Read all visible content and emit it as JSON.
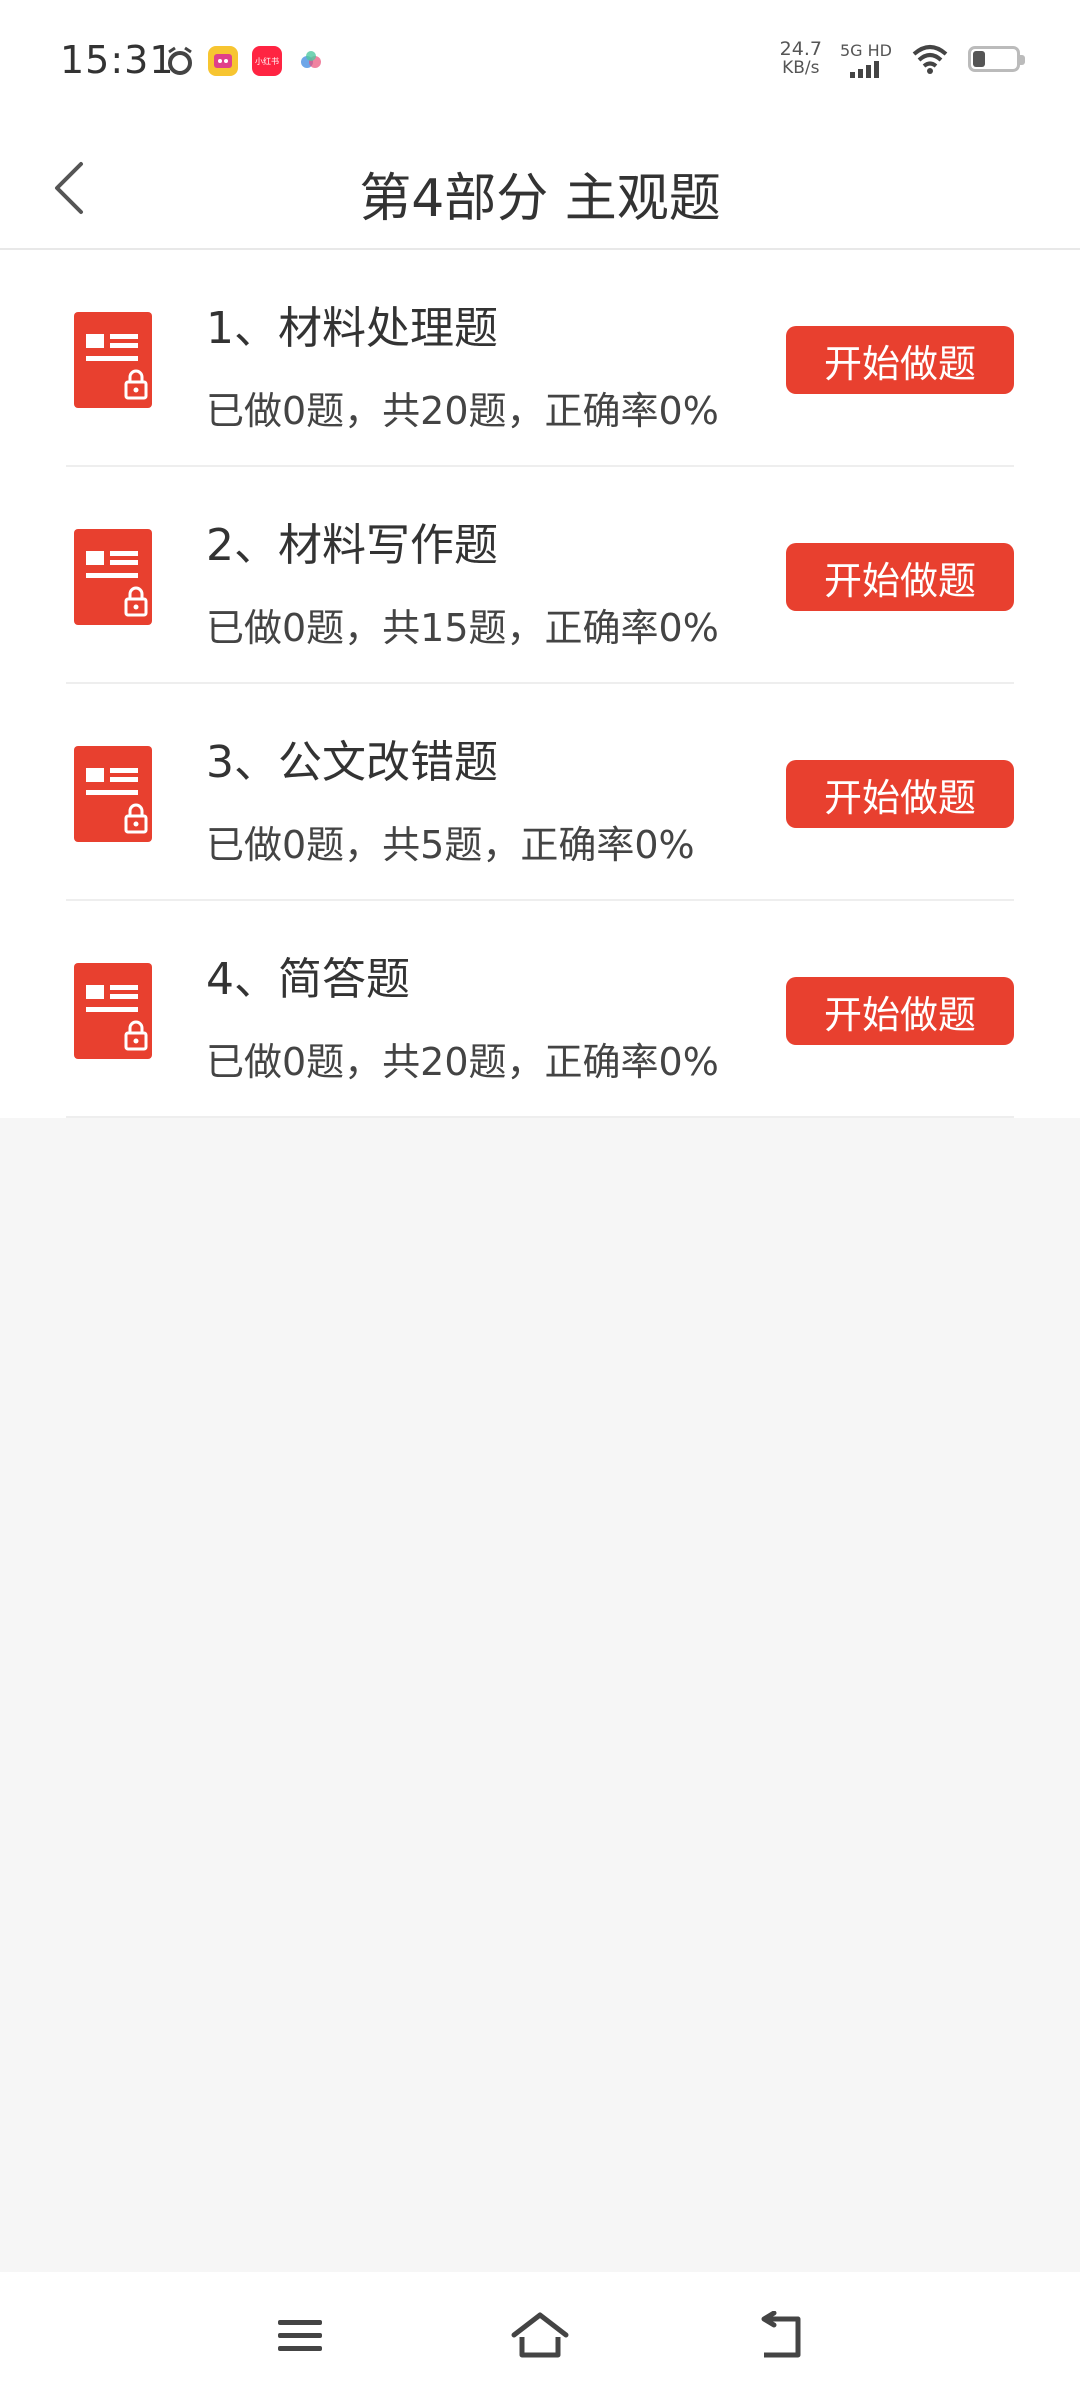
{
  "status_bar": {
    "time": "15:31",
    "net_speed_value": "24.7",
    "net_speed_unit": "KB/s",
    "network_type": "5G HD",
    "app_icons": [
      "alarm-icon",
      "app-icon-yellow",
      "app-icon-red",
      "app-icon-blue"
    ],
    "app_red_label": "小红书"
  },
  "header": {
    "title": "第4部分 主观题"
  },
  "items": [
    {
      "title": "1、材料处理题",
      "stats": "已做0题，共20题，正确率0%",
      "button": "开始做题"
    },
    {
      "title": "2、材料写作题",
      "stats": "已做0题，共15题，正确率0%",
      "button": "开始做题"
    },
    {
      "title": "3、公文改错题",
      "stats": "已做0题，共5题，正确率0%",
      "button": "开始做题"
    },
    {
      "title": "4、简答题",
      "stats": "已做0题，共20题，正确率0%",
      "button": "开始做题"
    }
  ],
  "colors": {
    "accent": "#e8402f",
    "background": "#f6f6f6",
    "surface": "#ffffff",
    "text": "#333333"
  },
  "icons": {
    "back": "chevron-left-icon",
    "item": "locked-document-icon",
    "nav_menu": "menu-icon",
    "nav_home": "home-icon",
    "nav_back": "back-arrow-icon"
  }
}
